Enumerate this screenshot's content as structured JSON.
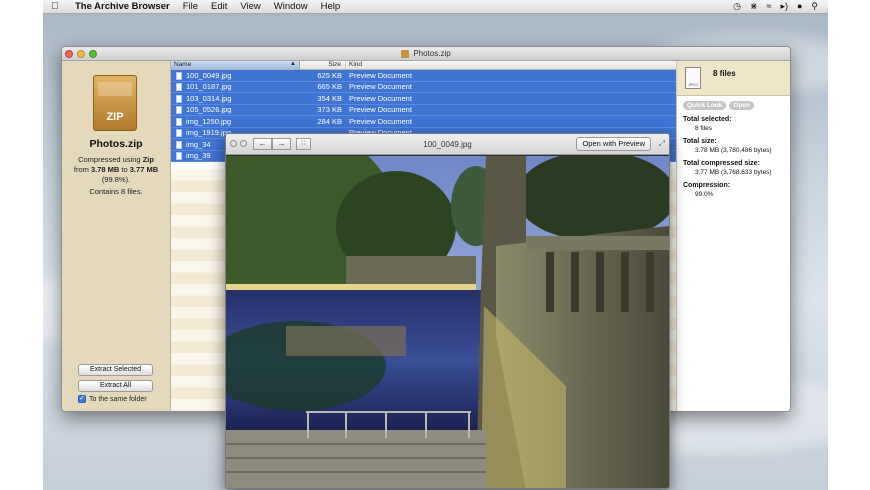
{
  "menubar": {
    "app_name": "The Archive Browser",
    "items": [
      "File",
      "Edit",
      "View",
      "Window",
      "Help"
    ]
  },
  "window": {
    "title": "Photos.zip"
  },
  "left_panel": {
    "icon_label": "ZIP",
    "archive_name": "Photos.zip",
    "compressed_using_prefix": "Compressed using ",
    "method": "Zip",
    "from_prefix": "from ",
    "original_size": "3.78 MB",
    "to_word": " to ",
    "compressed_size": "3.77 MB",
    "ratio": "(99.8%).",
    "contains": "Contains 8 files.",
    "extract_selected": "Extract Selected",
    "extract_all": "Extract All",
    "same_folder_label": "To the same folder",
    "same_folder_checked": true
  },
  "file_list": {
    "headers": {
      "name": "Name",
      "size": "Size",
      "kind": "Kind"
    },
    "rows": [
      {
        "name": "100_0049.jpg",
        "size": "625 KB",
        "kind": "Preview Document"
      },
      {
        "name": "101_0187.jpg",
        "size": "665 KB",
        "kind": "Preview Document"
      },
      {
        "name": "103_0314.jpg",
        "size": "354 KB",
        "kind": "Preview Document"
      },
      {
        "name": "105_0526.jpg",
        "size": "373 KB",
        "kind": "Preview Document"
      },
      {
        "name": "img_1250.jpg",
        "size": "284 KB",
        "kind": "Preview Document"
      },
      {
        "name": "img_1919.jpg",
        "size": "",
        "kind": "Preview Document"
      },
      {
        "name": "img_34",
        "size": "",
        "kind": ""
      },
      {
        "name": "img_39",
        "size": "",
        "kind": ""
      }
    ]
  },
  "info_panel": {
    "files_count": "8 files",
    "quick_look": "Quick Look",
    "open": "Open",
    "total_selected_label": "Total selected:",
    "total_selected_value": "8 files",
    "total_size_label": "Total size:",
    "total_size_value": "3.78 MB (3,780,486 bytes)",
    "total_compressed_label": "Total compressed size:",
    "total_compressed_value": "3.77 MB (3,768,633 bytes)",
    "compression_label": "Compression:",
    "compression_value": "99.0%"
  },
  "viewer": {
    "title": "100_0049.jpg",
    "open_with": "Open with Preview"
  },
  "colors": {
    "selection": "#3f74d4",
    "sidebar_bg": "#e4d9bb"
  }
}
